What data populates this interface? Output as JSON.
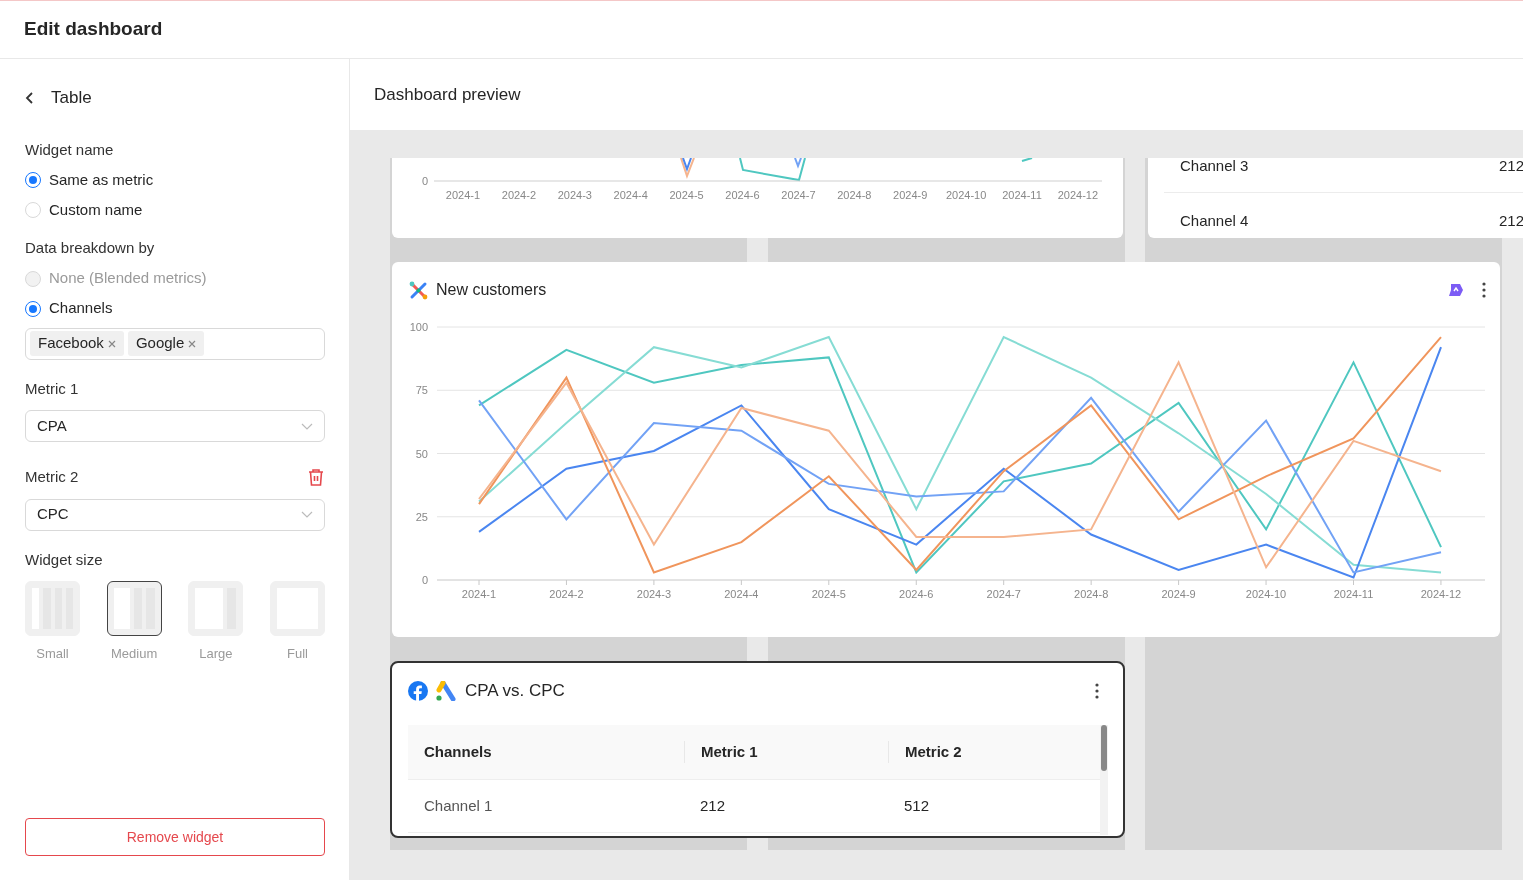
{
  "header": {
    "title": "Edit dashboard"
  },
  "sidebar": {
    "back_label": "Table",
    "widget_name": {
      "label": "Widget name",
      "options": [
        {
          "label": "Same as metric",
          "selected": true,
          "disabled": false
        },
        {
          "label": "Custom name",
          "selected": false,
          "disabled": false
        }
      ]
    },
    "breakdown": {
      "label": "Data breakdown by",
      "options": [
        {
          "label": "None (Blended metrics)",
          "selected": false,
          "disabled": true
        },
        {
          "label": "Channels",
          "selected": true,
          "disabled": false
        }
      ],
      "tags": [
        "Facebook",
        "Google"
      ]
    },
    "metrics": [
      {
        "label": "Metric 1",
        "value": "CPA",
        "removable": false
      },
      {
        "label": "Metric 2",
        "value": "CPC",
        "removable": true
      }
    ],
    "widget_size": {
      "label": "Widget size",
      "options": [
        {
          "label": "Small",
          "kind": "small",
          "selected": false
        },
        {
          "label": "Medium",
          "kind": "medium",
          "selected": true
        },
        {
          "label": "Large",
          "kind": "large",
          "selected": false
        },
        {
          "label": "Full",
          "kind": "full",
          "selected": false
        }
      ]
    },
    "remove_button": "Remove widget"
  },
  "preview": {
    "title": "Dashboard preview",
    "top_chart": {
      "y_tick": "0",
      "x_labels": [
        "2024-1",
        "2024-2",
        "2024-3",
        "2024-4",
        "2024-5",
        "2024-6",
        "2024-7",
        "2024-8",
        "2024-9",
        "2024-10",
        "2024-11",
        "2024-12"
      ]
    },
    "top_table": {
      "rows": [
        {
          "channel": "Channel 3",
          "value": "212"
        },
        {
          "channel": "Channel 4",
          "value": "212"
        }
      ]
    },
    "new_customers": {
      "title": "New customers",
      "chart_data": {
        "type": "line",
        "grid": true,
        "categories": [
          "2024-1",
          "2024-2",
          "2024-3",
          "2024-4",
          "2024-5",
          "2024-6",
          "2024-7",
          "2024-8",
          "2024-9",
          "2024-10",
          "2024-11",
          "2024-12"
        ],
        "ylim": [
          0,
          100
        ],
        "yticks": [
          0,
          25,
          50,
          75,
          100
        ],
        "series": [
          {
            "color": "#4fc7c0",
            "values": [
              69,
              91,
              78,
              85,
              88,
              3,
              39,
              46,
              70,
              20,
              86,
              13
            ]
          },
          {
            "color": "#86dcd4",
            "values": [
              31,
              62,
              92,
              84,
              96,
              28,
              96,
              80,
              58,
              34,
              6,
              3
            ]
          },
          {
            "color": "#4a86f0",
            "values": [
              19,
              44,
              51,
              69,
              28,
              14,
              44,
              18,
              4,
              14,
              1,
              92
            ]
          },
          {
            "color": "#72a2f5",
            "values": [
              71,
              24,
              62,
              59,
              38,
              33,
              35,
              72,
              27,
              63,
              3,
              11
            ]
          },
          {
            "color": "#f0955c",
            "values": [
              30,
              80,
              3,
              15,
              41,
              4,
              43,
              69,
              24,
              41,
              56,
              96
            ]
          },
          {
            "color": "#f5b48e",
            "values": [
              32,
              78,
              14,
              68,
              59,
              17,
              17,
              20,
              86,
              5,
              55,
              43
            ]
          }
        ]
      }
    },
    "cpa_table": {
      "title": "CPA vs. CPC",
      "columns": [
        "Channels",
        "Metric 1",
        "Metric 2"
      ],
      "rows": [
        [
          "Channel 1",
          "212",
          "512"
        ]
      ]
    }
  }
}
